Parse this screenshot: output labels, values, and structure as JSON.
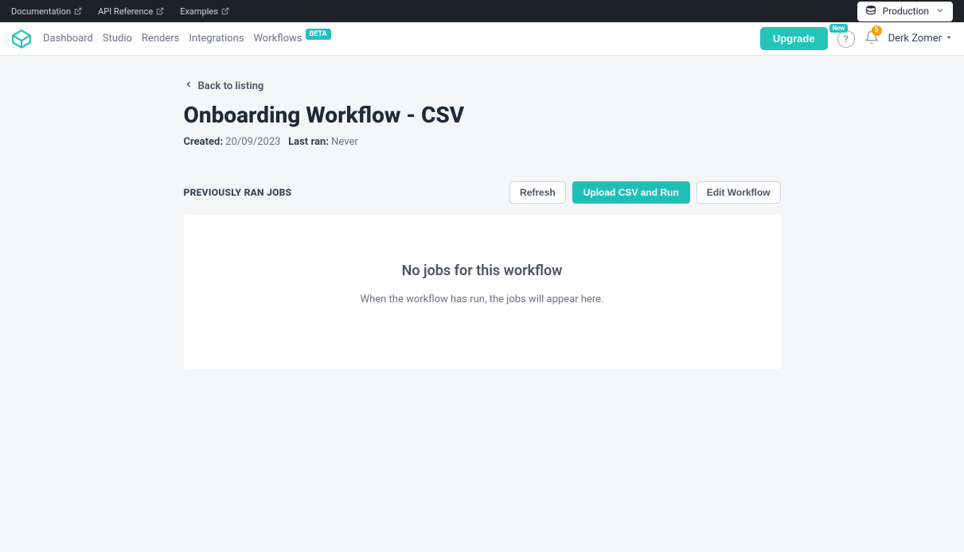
{
  "topbar": {
    "links": [
      {
        "label": "Documentation"
      },
      {
        "label": "API Reference"
      },
      {
        "label": "Examples"
      }
    ],
    "environment": "Production"
  },
  "nav": {
    "items": [
      {
        "label": "Dashboard"
      },
      {
        "label": "Studio"
      },
      {
        "label": "Renders"
      },
      {
        "label": "Integrations"
      },
      {
        "label": "Workflows",
        "badge": "BETA"
      }
    ],
    "upgrade": "Upgrade",
    "newBadge": "New",
    "notificationCount": "5",
    "user": "Derk Zomer"
  },
  "page": {
    "backLabel": "Back to listing",
    "title": "Onboarding Workflow - CSV",
    "createdLabel": "Created:",
    "createdValue": "20/09/2023",
    "lastRanLabel": "Last ran:",
    "lastRanValue": "Never"
  },
  "jobs": {
    "heading": "PREVIOUSLY RAN JOBS",
    "refreshBtn": "Refresh",
    "uploadBtn": "Upload CSV and Run",
    "editBtn": "Edit Workflow",
    "emptyTitle": "No jobs for this workflow",
    "emptyDesc": "When the workflow has run, the jobs will appear here."
  }
}
